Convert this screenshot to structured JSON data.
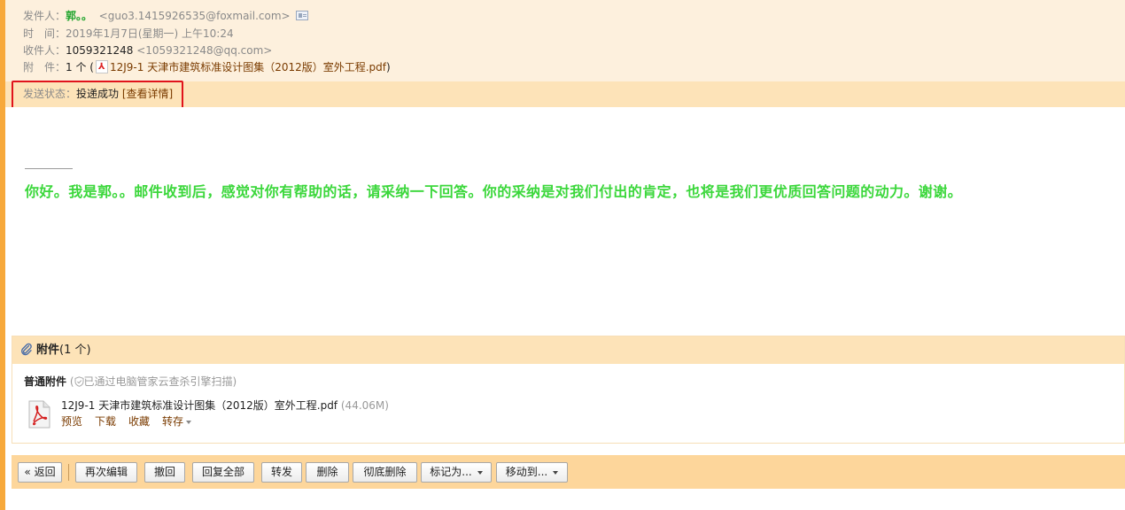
{
  "header": {
    "sender_label": "发件人：",
    "sender_name": "郭。。",
    "sender_email": "<guo3.1415926535@foxmail.com>",
    "time_label": "时　间：",
    "time_value": "2019年1月7日(星期一) 上午10:24",
    "recipient_label": "收件人：",
    "recipient_name": "1059321248",
    "recipient_email": "<1059321248@qq.com>",
    "attachment_label": "附　件：",
    "attachment_count": "1 个 (",
    "attachment_file": "12J9-1 天津市建筑标准设计图集（2012版）室外工程.pdf",
    "attachment_close": ")"
  },
  "status": {
    "label": "发送状态：",
    "value": "投递成功",
    "detail_link": "[查看详情]"
  },
  "body": {
    "text": "你好。我是郭。。邮件收到后，感觉对你有帮助的话，请采纳一下回答。你的采纳是对我们付出的肯定，也将是我们更优质回答问题的动力。谢谢。"
  },
  "attachments": {
    "title": "附件",
    "count": "(1 个)",
    "kind_label": "普通附件",
    "scan_open": "(",
    "scan_text": "已通过电脑管家云查杀引擎扫描",
    "scan_close": ")",
    "file": {
      "name": "12J9-1 天津市建筑标准设计图集（2012版）室外工程.pdf",
      "size": "(44.06M)",
      "actions": [
        "预览",
        "下载",
        "收藏",
        "转存"
      ]
    }
  },
  "toolbar": {
    "back": "« 返回",
    "reedit": "再次编辑",
    "recall": "撤回",
    "reply_all": "回复全部",
    "forward": "转发",
    "delete": "删除",
    "delete_permanent": "彻底删除",
    "mark_as": "标记为...",
    "move_to": "移动到..."
  },
  "colors": {
    "accent_orange": "#f7a93b",
    "header_bg": "#fdf0dd",
    "status_bg": "#fde3b8",
    "highlight_box": "#e0131b",
    "body_text_green": "#3bd73b"
  }
}
